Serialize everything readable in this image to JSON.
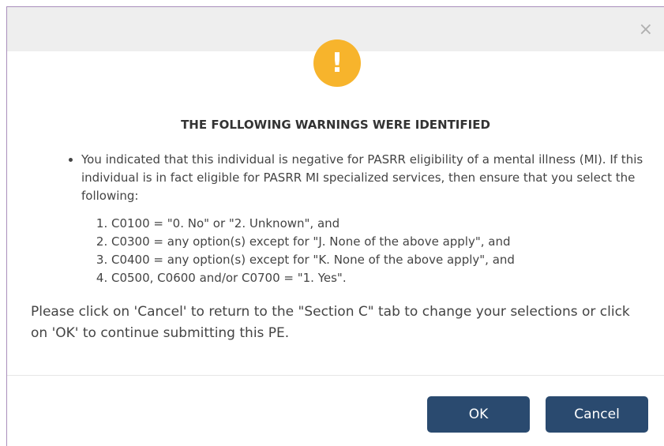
{
  "dialog": {
    "close_glyph": "×",
    "icon": "exclamation-warning-icon",
    "icon_glyph": "!",
    "title": "THE FOLLOWING WARNINGS WERE IDENTIFIED",
    "bullet_text": "You indicated that this individual is negative for PASRR eligibility of a mental illness (MI). If this individual is in fact eligible for PASRR MI specialized services, then ensure that you select the following:",
    "items": [
      "C0100 = \"0. No\" or \"2. Unknown\", and",
      "C0300 = any option(s) except for \"J. None of the above apply\", and",
      "C0400 = any option(s) except for \"K. None of the above apply\", and",
      "C0500, C0600 and/or C0700 = \"1. Yes\"."
    ],
    "footer_text": "Please click on 'Cancel' to return to the \"Section C\" tab to change your selections or click on 'OK' to continue submitting this PE.",
    "ok_label": "OK",
    "cancel_label": "Cancel",
    "colors": {
      "warning": "#f7b42c",
      "button": "#2a4a6f"
    }
  }
}
